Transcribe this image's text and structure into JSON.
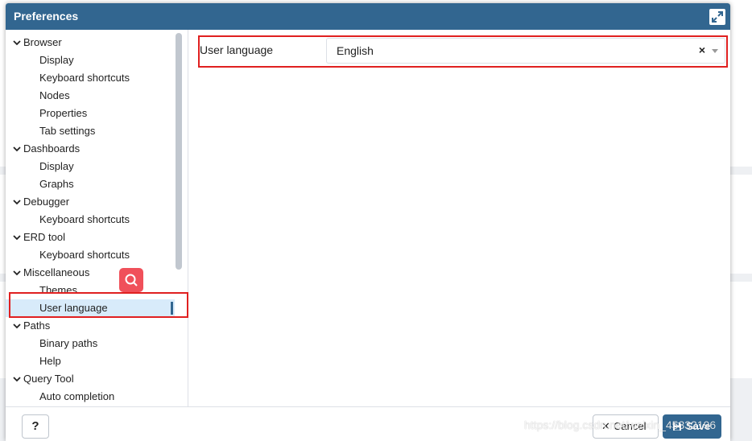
{
  "dialog": {
    "title": "Preferences"
  },
  "tree": {
    "groups": [
      {
        "label": "Browser",
        "children": [
          "Display",
          "Keyboard shortcuts",
          "Nodes",
          "Properties",
          "Tab settings"
        ]
      },
      {
        "label": "Dashboards",
        "children": [
          "Display",
          "Graphs"
        ]
      },
      {
        "label": "Debugger",
        "children": [
          "Keyboard shortcuts"
        ]
      },
      {
        "label": "ERD tool",
        "children": [
          "Keyboard shortcuts"
        ]
      },
      {
        "label": "Miscellaneous",
        "children": [
          "Themes",
          "User language"
        ]
      },
      {
        "label": "Paths",
        "children": [
          "Binary paths",
          "Help"
        ]
      },
      {
        "label": "Query Tool",
        "children": [
          "Auto completion"
        ]
      }
    ],
    "selected": "User language"
  },
  "content": {
    "field_label": "User language",
    "select_value": "English",
    "clear_symbol": "×"
  },
  "footer": {
    "help_label": "?",
    "cancel_icon": "✕",
    "cancel_label": "Cancel",
    "save_label": "Save"
  },
  "watermark": "https://blog.csdn.net/weixin_45332196",
  "colors": {
    "titlebar": "#326690",
    "selected_row": "#d8ebfa",
    "annotation": "#e02020",
    "search_fab": "#f0505a"
  }
}
